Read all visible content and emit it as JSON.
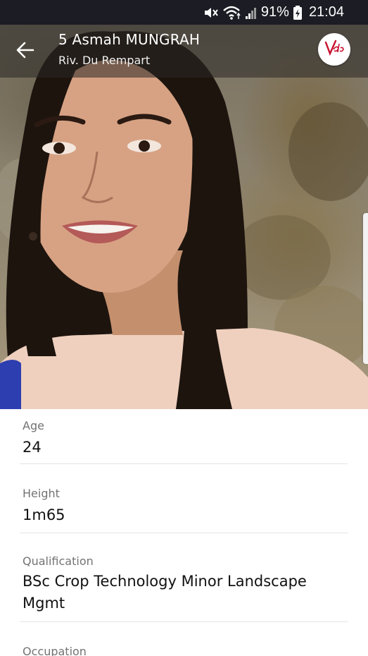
{
  "status_bar": {
    "battery": "91%",
    "time": "21:04",
    "icons": [
      "mute-icon",
      "wifi-icon",
      "signal-icon",
      "battery-icon"
    ]
  },
  "header": {
    "title": "5 Asmah MUNGRAH",
    "subtitle": "Riv. Du Rempart",
    "back_icon": "arrow-left-icon",
    "logo_icon": "vida-logo-icon"
  },
  "profile_photo": {
    "alt": "profile-photo"
  },
  "details": [
    {
      "label": "Age",
      "value": "24"
    },
    {
      "label": "Height",
      "value": "1m65"
    },
    {
      "label": "Qualification",
      "value": "BSc Crop Technology Minor Landscape Mgmt"
    },
    {
      "label": "Occupation",
      "value": ""
    }
  ],
  "colors": {
    "status_bar_bg": "#1c1c24",
    "logo_red": "#c8102e",
    "label_gray": "#737373"
  }
}
